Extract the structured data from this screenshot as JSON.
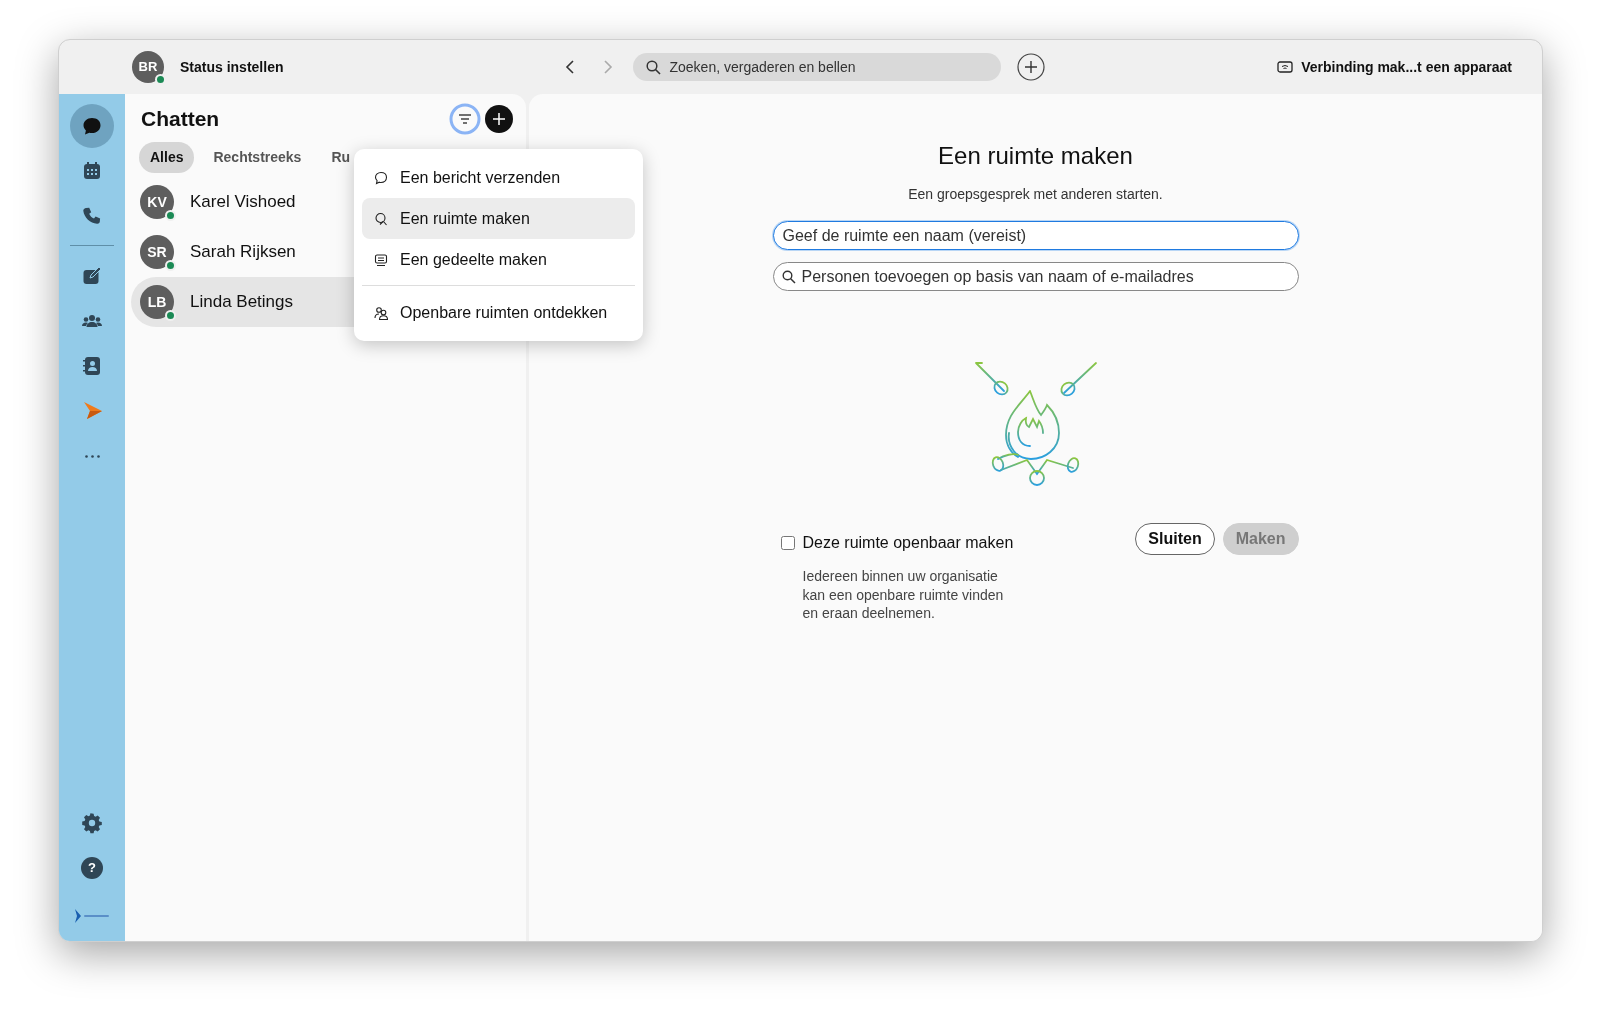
{
  "user": {
    "initials": "BR",
    "status_label": "Status instellen",
    "online": true
  },
  "nav": {
    "back_disabled": false,
    "forward_disabled": true
  },
  "search": {
    "placeholder": "Zoeken, vergaderen en bellen"
  },
  "device_link": "Verbinding mak...t een apparaat",
  "rail": [
    [
      {
        "kind": "chat",
        "selected": true
      },
      {
        "kind": "calendar",
        "selected": false
      },
      {
        "kind": "phone",
        "selected": false
      }
    ],
    [
      {
        "kind": "compose",
        "selected": false
      },
      {
        "kind": "team",
        "selected": false
      },
      {
        "kind": "contacts",
        "selected": false
      },
      {
        "kind": "app",
        "selected": false
      },
      {
        "kind": "more",
        "selected": false
      }
    ]
  ],
  "rail_bottom": [
    {
      "kind": "settings"
    },
    {
      "kind": "help",
      "glyph": "?"
    },
    {
      "kind": "logo"
    }
  ],
  "chats": {
    "title": "Chatten",
    "filter_active": true,
    "filters": [
      {
        "label": "Alles",
        "selected": true
      },
      {
        "label": "Rechtstreeks",
        "selected": false
      },
      {
        "label": "Ru",
        "selected": false
      }
    ],
    "conversations": [
      {
        "initials": "KV",
        "name": "Karel Vishoed",
        "online": true,
        "selected": false
      },
      {
        "initials": "SR",
        "name": "Sarah Rijksen",
        "online": true,
        "selected": false
      },
      {
        "initials": "LB",
        "name": "Linda Betings",
        "online": true,
        "selected": true
      }
    ]
  },
  "new_menu": {
    "groups": [
      [
        {
          "label": "Een bericht verzenden",
          "kind": "message",
          "selected": false
        },
        {
          "label": "Een ruimte maken",
          "kind": "space",
          "selected": true
        },
        {
          "label": "Een gedeelte maken",
          "kind": "section",
          "selected": false
        }
      ],
      [
        {
          "label": "Openbare ruimten ontdekken",
          "kind": "discover",
          "selected": false
        }
      ]
    ]
  },
  "create_space": {
    "title": "Een ruimte maken",
    "subtitle": "Een groepsgesprek met anderen starten.",
    "name_field": {
      "placeholder": "Geef de ruimte een naam (vereist)",
      "focused": true
    },
    "people_field": {
      "placeholder": "Personen toevoegen op basis van naam of e-mailadres"
    },
    "public": {
      "label": "Deze ruimte openbaar maken",
      "checked": false,
      "help": "Iedereen binnen uw organisatie kan een openbare ruimte vinden en eraan deelnemen."
    },
    "buttons": [
      {
        "label": "Sluiten",
        "disabled": false
      },
      {
        "label": "Maken",
        "disabled": true
      }
    ]
  }
}
